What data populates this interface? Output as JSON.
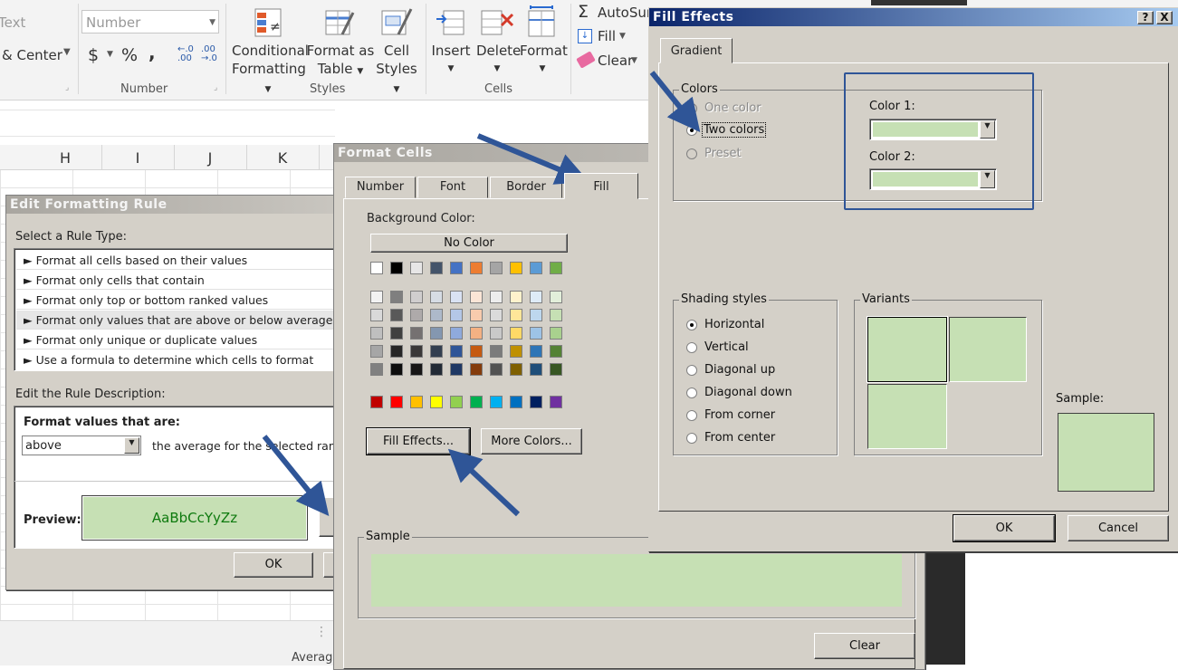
{
  "ribbon": {
    "text_label": "Text",
    "merge_center": "& Center",
    "number_format": "Number",
    "dollar": "$",
    "percent": "%",
    "comma": ",",
    "dec_inc": "←.0\n.00",
    "dec_dec": ".00\n→.0",
    "group_number": "Number",
    "conditional_formatting": [
      "Conditional",
      "Formatting"
    ],
    "format_as_table": [
      "Format as",
      "Table"
    ],
    "cell_styles": [
      "Cell",
      "Styles"
    ],
    "group_styles": "Styles",
    "insert": "Insert",
    "delete": "Delete",
    "format": "Format",
    "group_cells": "Cells",
    "autosum": "AutoSum",
    "fill": "Fill",
    "clear": "Clear"
  },
  "sheet": {
    "columns": [
      "H",
      "I",
      "J",
      "K"
    ],
    "status_average": "Average"
  },
  "edit_rule": {
    "title": "Edit Formatting Rule",
    "select_rule_type": "Select a Rule Type:",
    "rule_types": [
      "Format all cells based on their values",
      "Format only cells that contain",
      "Format only top or bottom ranked values",
      "Format only values that are above or below average",
      "Format only unique or duplicate values",
      "Use a formula to determine which cells to format"
    ],
    "selected_rule_index": 3,
    "edit_description": "Edit the Rule Description:",
    "format_values_that_are": "Format values that are:",
    "above_select": "above",
    "average_text": "the average for the selected range",
    "preview_label": "Preview:",
    "preview_text": "AaBbCcYyZz",
    "ok": "OK"
  },
  "format_cells": {
    "title": "Format Cells",
    "tabs": [
      "Number",
      "Font",
      "Border",
      "Fill"
    ],
    "active_tab": "Fill",
    "background_color": "Background Color:",
    "no_color": "No Color",
    "theme_row": [
      "#ffffff",
      "#000000",
      "#e7e6e6",
      "#44546a",
      "#4472c4",
      "#ed7d31",
      "#a5a5a5",
      "#ffc000",
      "#5b9bd5",
      "#70ad47"
    ],
    "tints": [
      [
        "#f2f2f2",
        "#7f7f7f",
        "#d0cece",
        "#d6dce4",
        "#d9e2f3",
        "#fbe5d6",
        "#ededed",
        "#fff2cc",
        "#deebf7",
        "#e2efda"
      ],
      [
        "#d9d9d9",
        "#595959",
        "#aeaaaa",
        "#adb9ca",
        "#b4c7e7",
        "#f8cbad",
        "#dbdbdb",
        "#ffe699",
        "#bdd7ee",
        "#c6e0b4"
      ],
      [
        "#bfbfbf",
        "#404040",
        "#757171",
        "#8497b0",
        "#8faadc",
        "#f4b183",
        "#c9c9c9",
        "#ffd966",
        "#9dc3e6",
        "#a9d18e"
      ],
      [
        "#a6a6a6",
        "#262626",
        "#3a3838",
        "#333f50",
        "#2f5597",
        "#c55a11",
        "#7b7b7b",
        "#bf9000",
        "#2e75b6",
        "#548235"
      ],
      [
        "#808080",
        "#0d0d0d",
        "#171616",
        "#222a35",
        "#1f3864",
        "#843c0c",
        "#525252",
        "#7f6000",
        "#1f4e79",
        "#385723"
      ]
    ],
    "standard_row": [
      "#c00000",
      "#ff0000",
      "#ffc000",
      "#ffff00",
      "#92d050",
      "#00b050",
      "#00b0f0",
      "#0070c0",
      "#002060",
      "#7030a0"
    ],
    "fill_effects_btn": "Fill Effects...",
    "more_colors_btn": "More Colors...",
    "sample_label": "Sample",
    "sample_color": "#c6e0b4",
    "clear_btn": "Clear"
  },
  "fill_effects": {
    "title": "Fill Effects",
    "help": "?",
    "close": "X",
    "tab_gradient": "Gradient",
    "colors_label": "Colors",
    "one_color": "One color",
    "two_colors": "Two colors",
    "preset": "Preset",
    "color1_label": "Color 1:",
    "color2_label": "Color 2:",
    "color1": "#c6e0b4",
    "color2": "#c6e0b4",
    "shading_label": "Shading styles",
    "shading_options": [
      "Horizontal",
      "Vertical",
      "Diagonal up",
      "Diagonal down",
      "From corner",
      "From center"
    ],
    "selected_shading": "Horizontal",
    "variants_label": "Variants",
    "sample_label": "Sample:",
    "ok": "OK",
    "cancel": "Cancel"
  },
  "colors": {
    "accent_blue": "#2f5597",
    "dialog_gray": "#d4d0c8",
    "preview_text_color": "#0e7a0e"
  }
}
